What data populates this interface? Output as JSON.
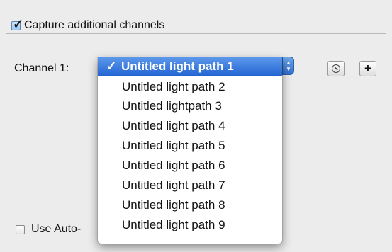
{
  "capture": {
    "label": "Capture additional channels",
    "checked": true,
    "check_glyph": "✓"
  },
  "channel": {
    "label": "Channel 1:"
  },
  "popup": {
    "selected_index": 0,
    "check_glyph": "✓",
    "items": [
      "Untitled light path 1",
      "Untitled light path 2",
      "Untitled lightpath 3",
      "Untitled light path 4",
      "Untitled light path 5",
      "Untitled light path 6",
      "Untitled light path 7",
      "Untitled light path 8",
      "Untitled light path 9"
    ],
    "accent_color": "#2f6fd1",
    "stepper_up": "▲",
    "stepper_down": "▼"
  },
  "buttons": {
    "plus_label": "+",
    "remove_icon": "circle-slash-icon"
  },
  "auto": {
    "label": "Use Auto-",
    "checked": false
  }
}
